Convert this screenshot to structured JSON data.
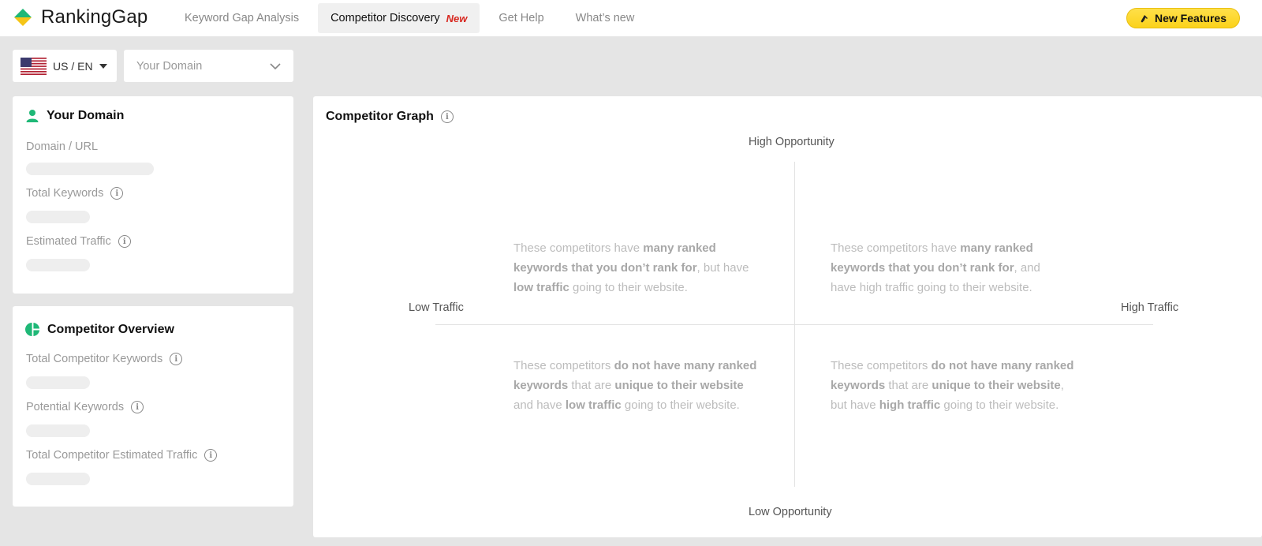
{
  "app": {
    "name": "RankingGap"
  },
  "nav": {
    "items": [
      {
        "label": "Keyword Gap Analysis"
      },
      {
        "label": "Competitor Discovery",
        "tag": "New"
      },
      {
        "label": "Get Help"
      },
      {
        "label": "What’s new"
      }
    ],
    "new_features_label": "New Features"
  },
  "controls": {
    "locale": "US / EN",
    "domain_placeholder": "Your Domain"
  },
  "your_domain": {
    "title": "Your Domain",
    "fields": [
      "Domain / URL",
      "Total Keywords",
      "Estimated Traffic"
    ]
  },
  "competitor_overview": {
    "title": "Competitor Overview",
    "fields": [
      "Total Competitor Keywords",
      "Potential Keywords",
      "Total Competitor Estimated Traffic"
    ]
  },
  "graph": {
    "title": "Competitor Graph",
    "axis": {
      "top": "High Opportunity",
      "bottom": "Low Opportunity",
      "left": "Low Traffic",
      "right": "High Traffic"
    },
    "quadrants": {
      "top_left": [
        "These competitors have ",
        "many ranked keywords that you don’t rank for",
        ", but have ",
        "low traffic",
        " going to their website."
      ],
      "top_right": [
        "These competitors have ",
        "many ranked keywords that you don’t rank for",
        ", and have high traffic going to their website."
      ],
      "bottom_left": [
        "These competitors ",
        "do not have many ranked keywords",
        " that are ",
        "unique to their website",
        " and have ",
        "low traffic",
        " going to their website."
      ],
      "bottom_right": [
        "These competitors ",
        "do not have many ranked keywords",
        " that are ",
        "unique to their website",
        ", but have ",
        "high traffic",
        " going to their website."
      ]
    }
  },
  "colors": {
    "accent_green": "#1fb877",
    "logo_yellow": "#f5c518",
    "new_tag_red": "#d7261e",
    "features_yellow": "#fbd21a"
  },
  "icons": {
    "user": "user-icon",
    "pie": "pie-chart-icon",
    "info": "info-icon",
    "bell": "bell-icon",
    "chevron": "chevron-down-icon",
    "caret": "caret-down-icon",
    "flag": "us-flag-icon"
  }
}
